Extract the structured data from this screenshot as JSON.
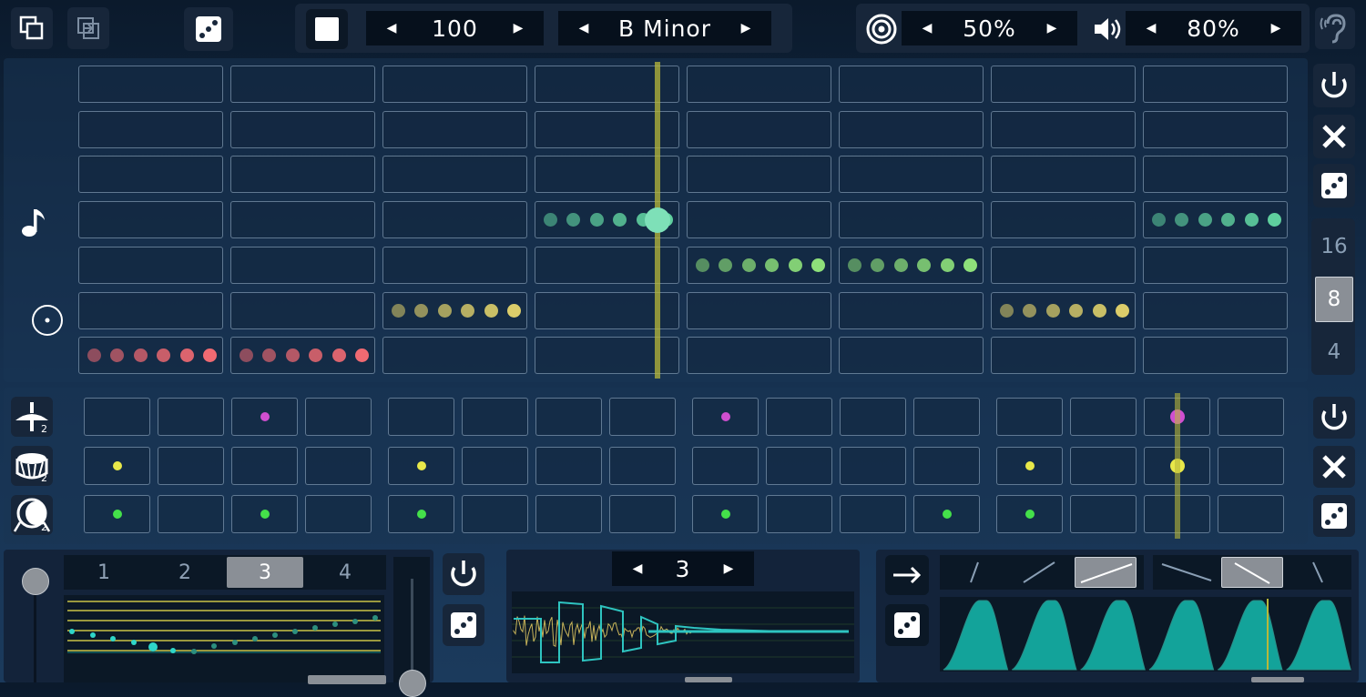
{
  "toolbar": {
    "tempo": {
      "value": "100"
    },
    "scale": {
      "value": "B Minor"
    },
    "accuracy": {
      "value": "50%"
    },
    "volume": {
      "value": "80%"
    }
  },
  "melody": {
    "resolution_options": [
      "16",
      "8",
      "4"
    ],
    "resolution_selected": "8",
    "rows": 7,
    "columns": 8,
    "playhead_step": 0.81,
    "notes": [
      {
        "row": 3,
        "col": 3,
        "color": "#5fcf9e"
      },
      {
        "row": 3,
        "col": 7,
        "color": "#5fcf9e"
      },
      {
        "row": 4,
        "col": 4,
        "color": "#8ee07a"
      },
      {
        "row": 4,
        "col": 5,
        "color": "#8ee07a"
      },
      {
        "row": 5,
        "col": 2,
        "color": "#dccd6a"
      },
      {
        "row": 5,
        "col": 6,
        "color": "#dccd6a"
      },
      {
        "row": 6,
        "col": 0,
        "color": "#f06a72"
      },
      {
        "row": 6,
        "col": 1,
        "color": "#f06a72"
      }
    ]
  },
  "drums": {
    "rows": [
      "hihat",
      "snare",
      "kick"
    ],
    "columns": 16,
    "row_badges": [
      "2",
      "2",
      "2"
    ],
    "playhead_step": 14,
    "hits": [
      {
        "row": 0,
        "col": 2,
        "color": "#d04fd0"
      },
      {
        "row": 0,
        "col": 8,
        "color": "#d04fd0"
      },
      {
        "row": 0,
        "col": 14,
        "color": "#d04fd0"
      },
      {
        "row": 1,
        "col": 0,
        "color": "#e8e84a"
      },
      {
        "row": 1,
        "col": 4,
        "color": "#e8e84a"
      },
      {
        "row": 1,
        "col": 12,
        "color": "#e8e84a"
      },
      {
        "row": 1,
        "col": 14,
        "color": "#e8e84a"
      },
      {
        "row": 2,
        "col": 0,
        "color": "#44e04a"
      },
      {
        "row": 2,
        "col": 2,
        "color": "#44e04a"
      },
      {
        "row": 2,
        "col": 4,
        "color": "#44e04a"
      },
      {
        "row": 2,
        "col": 8,
        "color": "#44e04a"
      },
      {
        "row": 2,
        "col": 11,
        "color": "#44e04a"
      },
      {
        "row": 2,
        "col": 12,
        "color": "#44e04a"
      }
    ]
  },
  "bottom": {
    "tabs": [
      "1",
      "2",
      "3",
      "4"
    ],
    "tab_selected": "3",
    "waveform_stepper": {
      "value": "3"
    }
  },
  "colors": {
    "accent_teal": "#13a39a",
    "playhead": "#b8b83a",
    "background": "#0b1a2c"
  }
}
